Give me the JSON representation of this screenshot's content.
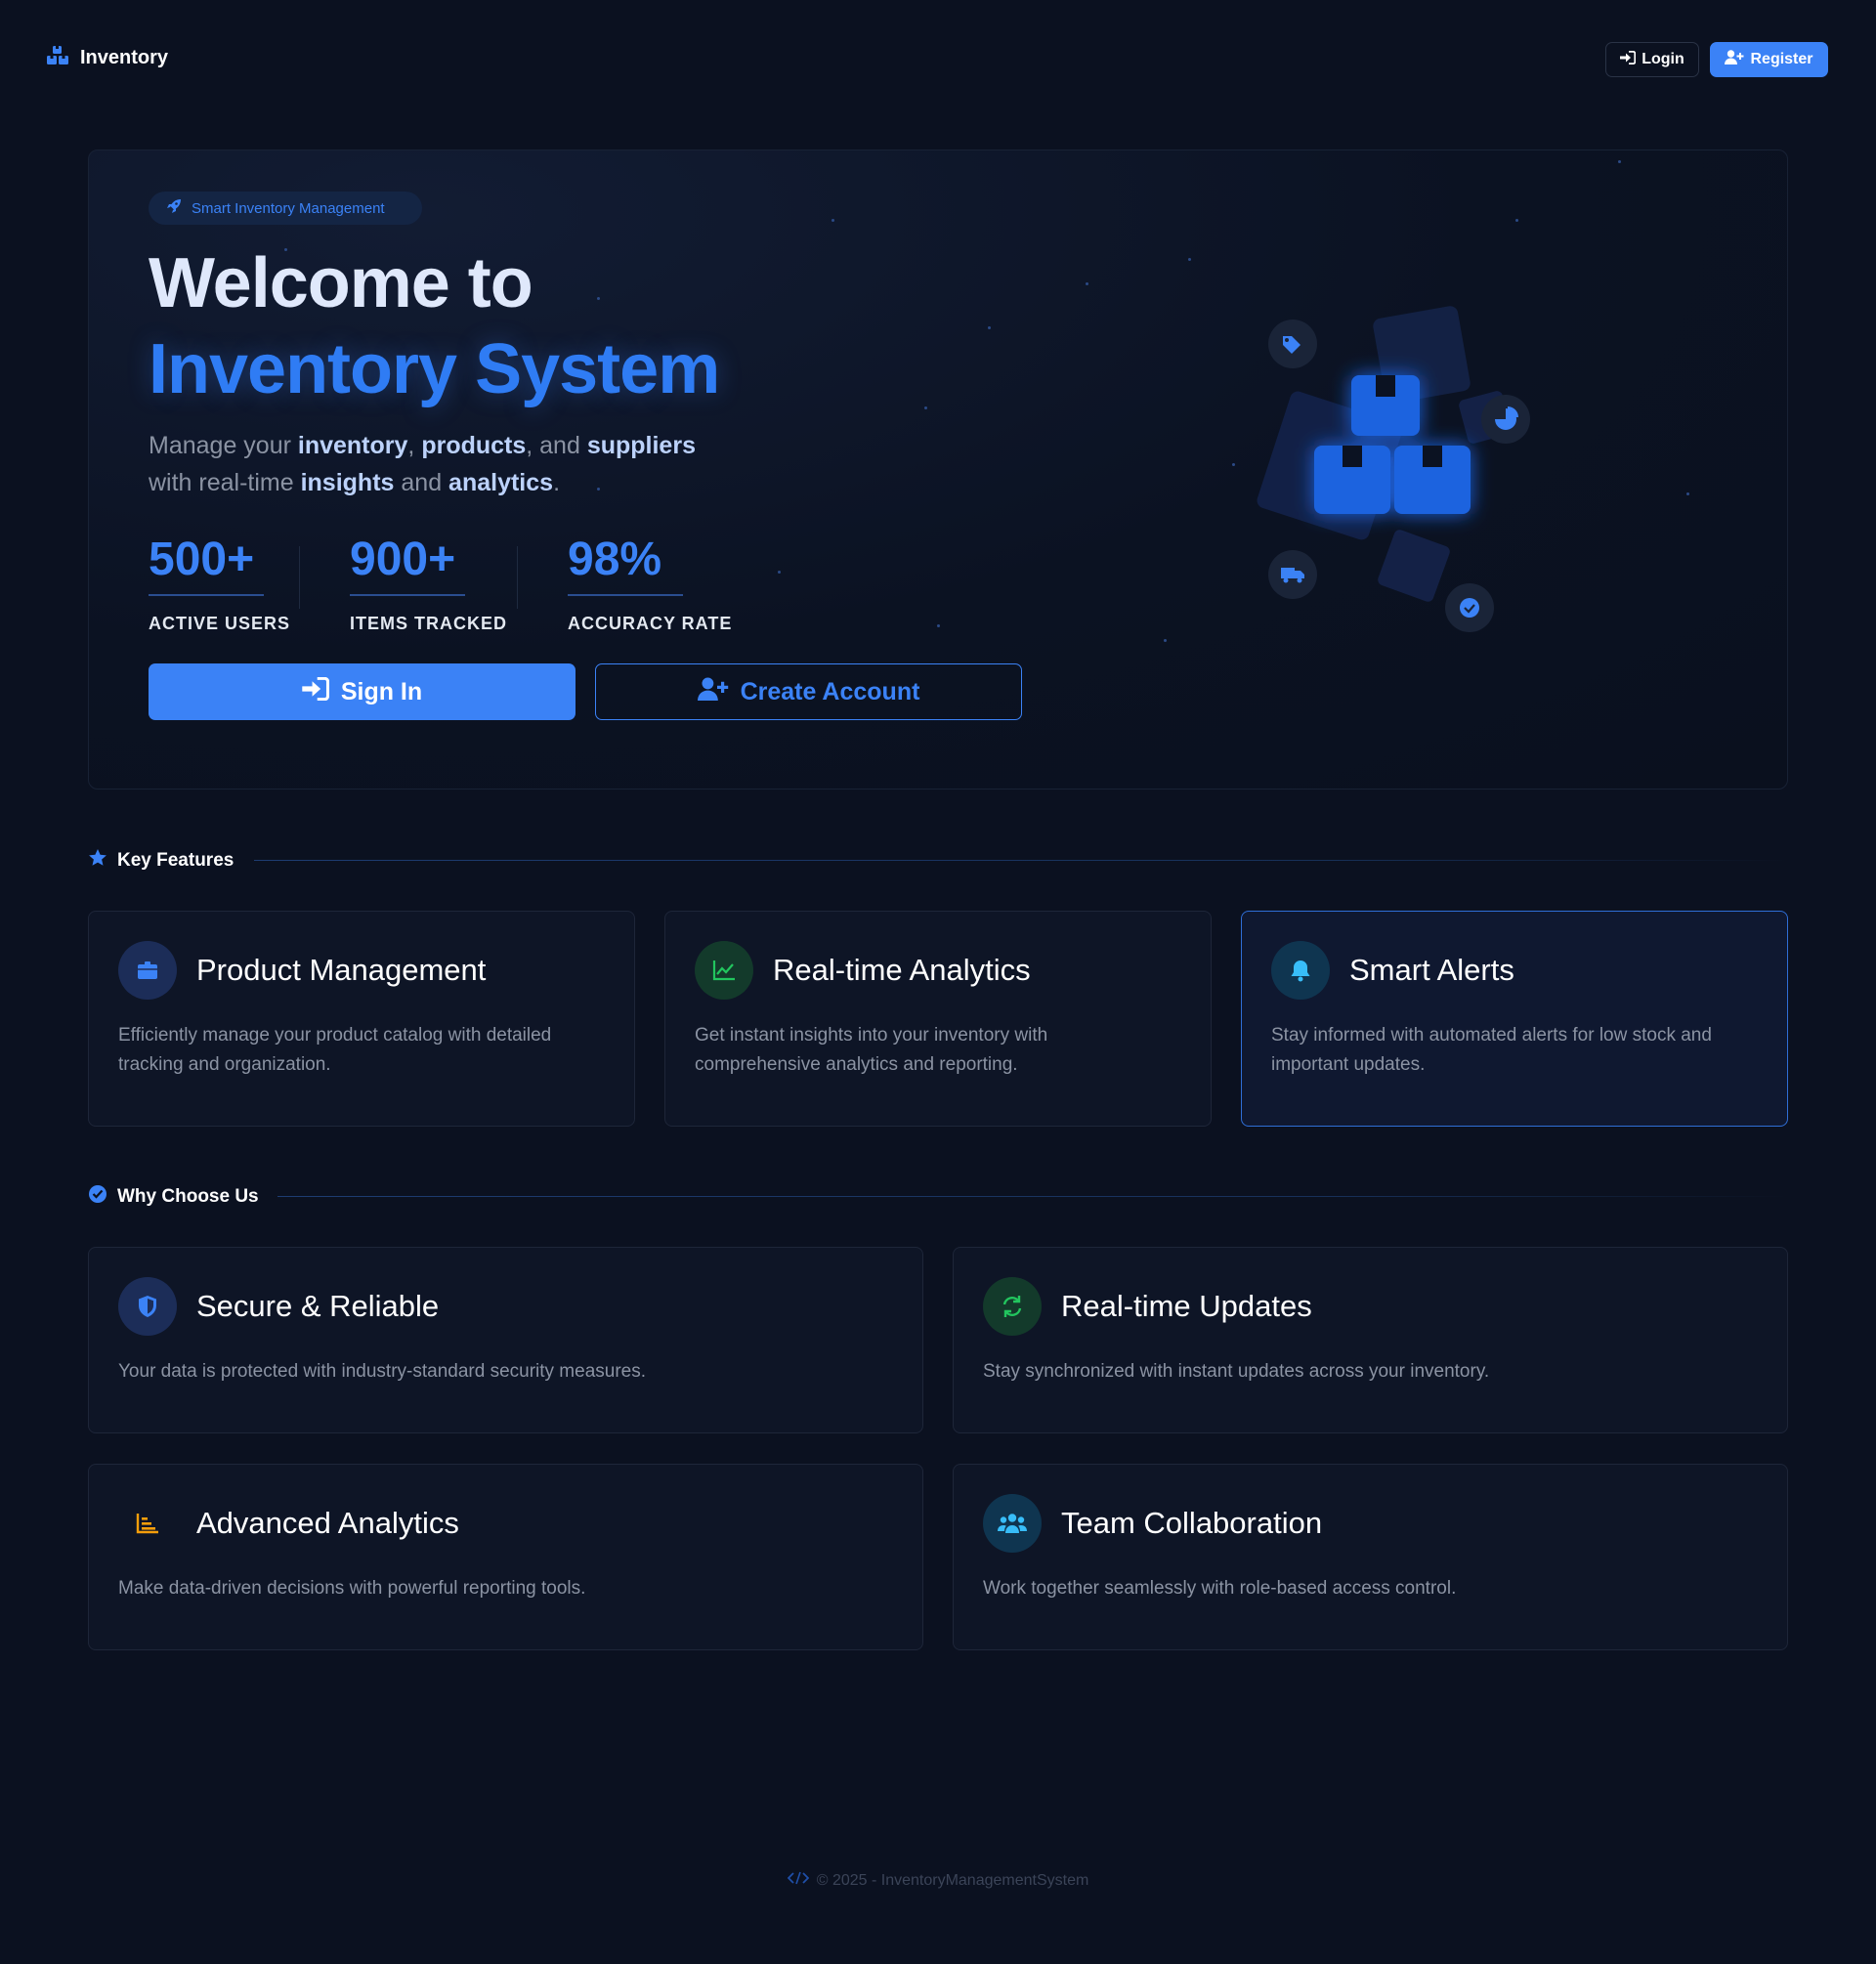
{
  "nav": {
    "brand": "Inventory",
    "login_label": "Login",
    "register_label": "Register"
  },
  "hero": {
    "badge": "Smart Inventory Management",
    "title_line1": "Welcome to",
    "title_line2": "Inventory System",
    "subtitle": {
      "t1": "Manage your ",
      "k1": "inventory",
      "t2": ", ",
      "k2": "products",
      "t3": ", and ",
      "k3": "suppliers",
      "t4": "with real-time ",
      "k4": "insights",
      "t5": " and ",
      "k5": "analytics",
      "t6": "."
    },
    "stats": [
      {
        "value": "500+",
        "label": "ACTIVE USERS"
      },
      {
        "value": "900+",
        "label": "ITEMS TRACKED"
      },
      {
        "value": "98%",
        "label": "ACCURACY RATE"
      }
    ],
    "signin_label": "Sign In",
    "create_label": "Create Account"
  },
  "key_features": {
    "heading": "Key Features",
    "cards": [
      {
        "title": "Product Management",
        "desc": "Efficiently manage your product catalog with detailed tracking and organization.",
        "icon": "box-icon"
      },
      {
        "title": "Real-time Analytics",
        "desc": "Get instant insights into your inventory with comprehensive analytics and reporting.",
        "icon": "chart-line-icon"
      },
      {
        "title": "Smart Alerts",
        "desc": "Stay informed with automated alerts for low stock and important updates.",
        "icon": "bell-icon"
      }
    ]
  },
  "why_choose": {
    "heading": "Why Choose Us",
    "cards": [
      {
        "title": "Secure & Reliable",
        "desc": "Your data is protected with industry-standard security measures.",
        "icon": "shield-icon"
      },
      {
        "title": "Real-time Updates",
        "desc": "Stay synchronized with instant updates across your inventory.",
        "icon": "sync-icon"
      },
      {
        "title": "Advanced Analytics",
        "desc": "Make data-driven decisions with powerful reporting tools.",
        "icon": "bar-chart-icon"
      },
      {
        "title": "Team Collaboration",
        "desc": "Work together seamlessly with role-based access control.",
        "icon": "users-icon"
      }
    ]
  },
  "footer": {
    "text": "© 2025 - InventoryManagementSystem"
  },
  "colors": {
    "background": "#0b1120",
    "accent": "#3b82f6",
    "green": "#22c55e",
    "cyan": "#38bdf8",
    "amber": "#f59e0b"
  }
}
